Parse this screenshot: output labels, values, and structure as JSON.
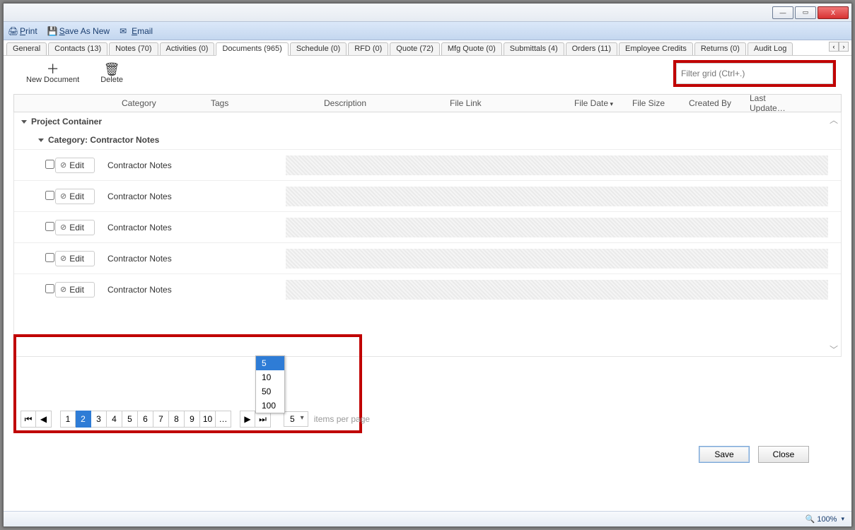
{
  "window_controls": {
    "min": "—",
    "max": "▭",
    "close": "X"
  },
  "toolbar": {
    "print": "Print",
    "save_as_new": "Save As New",
    "email": "Email"
  },
  "tabs": [
    {
      "label": "General"
    },
    {
      "label": "Contacts (13)"
    },
    {
      "label": "Notes (70)"
    },
    {
      "label": "Activities (0)"
    },
    {
      "label": "Documents (965)",
      "active": true
    },
    {
      "label": "Schedule (0)"
    },
    {
      "label": "RFD (0)"
    },
    {
      "label": "Quote (72)"
    },
    {
      "label": "Mfg Quote (0)"
    },
    {
      "label": "Submittals (4)"
    },
    {
      "label": "Orders (11)"
    },
    {
      "label": "Employee Credits"
    },
    {
      "label": "Returns (0)"
    },
    {
      "label": "Audit Log"
    }
  ],
  "actions": {
    "new_doc": "New Document",
    "delete": "Delete"
  },
  "filter_placeholder": "Filter grid (Ctrl+.)",
  "columns": [
    "",
    "",
    "Category",
    "Tags",
    "Description",
    "File Link",
    "File Date",
    "File Size",
    "Created By",
    "Last Update…"
  ],
  "group_top": "Project Container",
  "group_sub": "Category: Contractor Notes",
  "edit_label": "Edit",
  "rows": [
    {
      "category": "Contractor Notes"
    },
    {
      "category": "Contractor Notes"
    },
    {
      "category": "Contractor Notes"
    },
    {
      "category": "Contractor Notes"
    },
    {
      "category": "Contractor Notes"
    }
  ],
  "pager": {
    "pages": [
      "1",
      "2",
      "3",
      "4",
      "5",
      "6",
      "7",
      "8",
      "9",
      "10",
      "…"
    ],
    "active_index": 1,
    "size_options": [
      "5",
      "10",
      "50",
      "100"
    ],
    "size_selected": "5",
    "items_per_page": "items per page"
  },
  "buttons": {
    "save": "Save",
    "close": "Close"
  },
  "status": {
    "zoom": "100%"
  }
}
